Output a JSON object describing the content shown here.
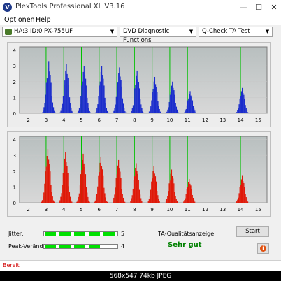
{
  "window": {
    "title": "PlexTools Professional XL V3.16",
    "app_icon_letter": "V",
    "minimize": "—",
    "maximize": "☐",
    "close": "✕"
  },
  "menu": [
    "Optionen",
    "Help"
  ],
  "toolbar": {
    "drive": "HA:3 ID:0  PX-755UF",
    "function": "DVD Diagnostic Functions",
    "test": "Q-Check TA Test",
    "arrow": "▼"
  },
  "colors": {
    "top_bars": "#1a2ccc",
    "bottom_bars": "#e01808",
    "guide_lines": "#00c000",
    "plot_bg": "#d8d8d8",
    "plot_bg_top": "#b8bfbf"
  },
  "chart_data": [
    {
      "type": "bar",
      "y_ticks": [
        "0",
        "1",
        "2",
        "3",
        "4"
      ],
      "x_ticks": [
        "2",
        "3",
        "4",
        "5",
        "6",
        "7",
        "8",
        "9",
        "10",
        "11",
        "12",
        "13",
        "14",
        "15"
      ],
      "ylim": [
        0,
        4.2
      ],
      "xlim": [
        1.5,
        15.5
      ],
      "guide_lines_x": [
        3,
        4,
        5,
        6,
        7,
        8,
        9,
        10,
        11,
        14
      ],
      "peaks": [
        {
          "center": 3.15,
          "height": 3.3
        },
        {
          "center": 4.15,
          "height": 3.1
        },
        {
          "center": 5.15,
          "height": 3.0
        },
        {
          "center": 6.15,
          "height": 3.0
        },
        {
          "center": 7.15,
          "height": 2.9
        },
        {
          "center": 8.15,
          "height": 2.7
        },
        {
          "center": 9.15,
          "height": 2.3
        },
        {
          "center": 10.15,
          "height": 2.0
        },
        {
          "center": 11.15,
          "height": 1.4
        },
        {
          "center": 14.1,
          "height": 1.6
        }
      ]
    },
    {
      "type": "bar",
      "y_ticks": [
        "0",
        "1",
        "2",
        "3",
        "4"
      ],
      "x_ticks": [
        "2",
        "3",
        "4",
        "5",
        "6",
        "7",
        "8",
        "9",
        "10",
        "11",
        "12",
        "13",
        "14",
        "15"
      ],
      "ylim": [
        0,
        4.2
      ],
      "xlim": [
        1.5,
        15.5
      ],
      "guide_lines_x": [
        3,
        4,
        5,
        6,
        7,
        8,
        9,
        10,
        11,
        14
      ],
      "peaks": [
        {
          "center": 3.1,
          "height": 3.4
        },
        {
          "center": 4.1,
          "height": 3.2
        },
        {
          "center": 5.1,
          "height": 3.1
        },
        {
          "center": 6.1,
          "height": 2.9
        },
        {
          "center": 7.1,
          "height": 2.7
        },
        {
          "center": 8.1,
          "height": 2.5
        },
        {
          "center": 9.1,
          "height": 2.3
        },
        {
          "center": 10.1,
          "height": 2.1
        },
        {
          "center": 11.1,
          "height": 1.5
        },
        {
          "center": 14.1,
          "height": 1.7
        }
      ]
    }
  ],
  "ratings": {
    "jitter_label": "Jitter:",
    "jitter_value": "5",
    "jitter_level": 5,
    "peak_label": "Peak-Veränd:",
    "peak_value": "4",
    "peak_level": 4,
    "max_level": 5,
    "quality_label": "TA-Qualitätsanzeige:",
    "quality_value": "Sehr gut"
  },
  "buttons": {
    "start": "Start",
    "info_icon": "i"
  },
  "status": "Bereit",
  "footer": "568x547 74kb JPEG"
}
